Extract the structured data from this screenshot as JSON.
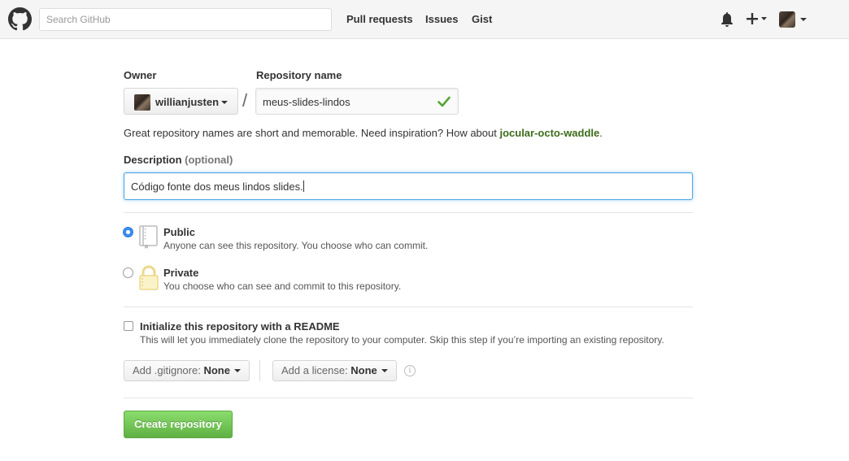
{
  "header": {
    "search_placeholder": "Search GitHub",
    "nav": [
      "Pull requests",
      "Issues",
      "Gist"
    ],
    "icons": [
      "github-logo-icon",
      "bell-icon",
      "plus-icon",
      "avatar"
    ]
  },
  "form": {
    "owner_label": "Owner",
    "owner_value": "willianjusten",
    "separator": "/",
    "repo_label": "Repository name",
    "repo_value": "meus-slides-lindos",
    "hint_text": "Great repository names are short and memorable. Need inspiration? How about ",
    "hint_suggestion": "jocular-octo-waddle",
    "hint_end": ".",
    "description_label": "Description",
    "description_optional": "(optional)",
    "description_value": "Código fonte dos meus lindos slides.",
    "visibility": {
      "public_title": "Public",
      "public_note": "Anyone can see this repository. You choose who can commit.",
      "private_title": "Private",
      "private_note": "You choose who can see and commit to this repository.",
      "selected": "Public"
    },
    "readme": {
      "title": "Initialize this repository with a README",
      "note": "This will let you immediately clone the repository to your computer. Skip this step if you’re importing an existing repository.",
      "checked": false
    },
    "gitignore_label": "Add .gitignore: ",
    "gitignore_value": "None",
    "license_label": "Add a license: ",
    "license_value": "None",
    "info_glyph": "i",
    "submit_label": "Create repository"
  },
  "colors": {
    "accent_blue": "#51a7e8",
    "success_green": "#60b044",
    "suggestion_green": "#3d6b1a"
  }
}
